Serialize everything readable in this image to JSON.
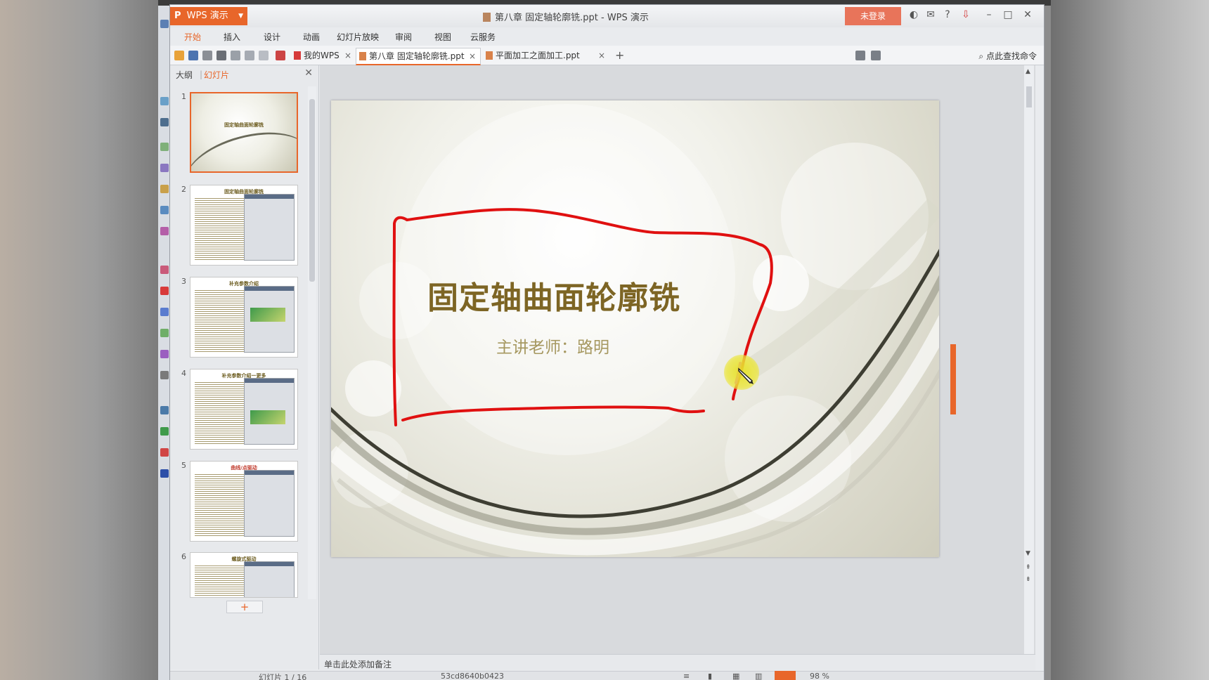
{
  "titlebar": {
    "app_name": "WPS 演示",
    "window_title": "第八章 固定轴轮廓铣.ppt - WPS 演示",
    "login_label": "未登录"
  },
  "menu": [
    "开始",
    "插入",
    "设计",
    "动画",
    "幻灯片放映",
    "审阅",
    "视图",
    "云服务"
  ],
  "tabs": {
    "my_wps": "我的WPS",
    "doc1": "第八章 固定轴轮廓铣.ppt",
    "doc2": "平面加工之面加工.ppt",
    "search_cmd": "点此查找命令"
  },
  "pane": {
    "tab_outline": "大纲",
    "tab_slides": "幻灯片",
    "thumbnails": [
      {
        "num": "1",
        "title": "固定轴曲面轮廓铣"
      },
      {
        "num": "2",
        "title": "固定轴曲面轮廓铣"
      },
      {
        "num": "3",
        "title": "补充参数介绍"
      },
      {
        "num": "4",
        "title": "补充参数介绍一更多"
      },
      {
        "num": "5",
        "title": "曲线/点驱动"
      },
      {
        "num": "6",
        "title": "螺旋式驱动"
      }
    ]
  },
  "slide": {
    "title": "固定轴曲面轮廓铣",
    "subtitle": "主讲老师：路明"
  },
  "notes_placeholder": "单击此处添加备注",
  "status": {
    "slide_counter": "幻灯片 1 / 16",
    "theme_code": "53cd8640b0423",
    "zoom": "98 %"
  },
  "colors": {
    "accent": "#e8662a",
    "title_color": "#7d6524",
    "annotation_red": "#e01010"
  }
}
